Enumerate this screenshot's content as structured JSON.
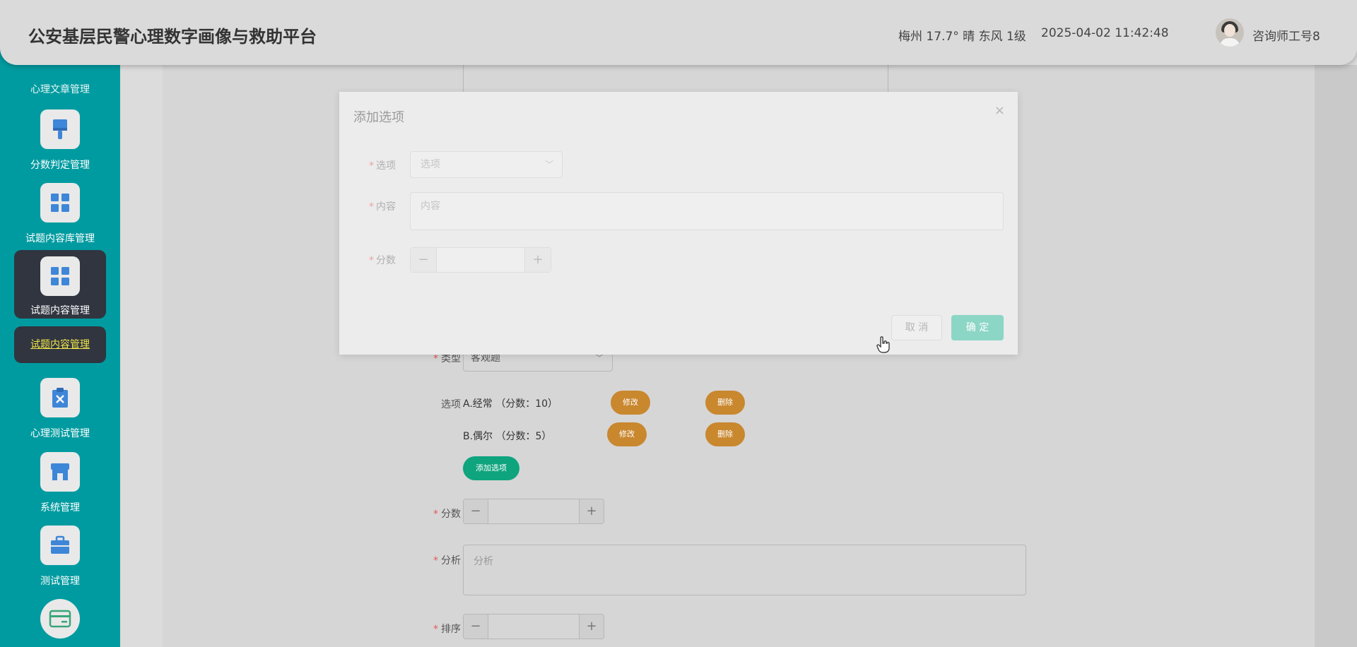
{
  "header": {
    "title": "公安基层民警心理数字画像与救助平台",
    "weather": "梅州 17.7° 晴 东风 1级",
    "datetime": "2025-04-02 11:42:48",
    "username": "咨询师工号8"
  },
  "sidebar": {
    "cut_label": "心理文章管理",
    "items": [
      {
        "label": "分数判定管理",
        "icon": "brush-icon"
      },
      {
        "label": "试题内容库管理",
        "icon": "grid-icon"
      },
      {
        "label": "试题内容管理",
        "icon": "grid-icon"
      },
      {
        "label": "心理测试管理",
        "icon": "clipboard-x-icon"
      },
      {
        "label": "系统管理",
        "icon": "store-icon"
      },
      {
        "label": "测试管理",
        "icon": "briefcase-icon"
      },
      {
        "label": "",
        "icon": "card-icon"
      }
    ],
    "active_sub": "试题内容管理",
    "accent": "#009ba0"
  },
  "form": {
    "type_label": "类型",
    "type_value": "客观题",
    "options_label": "选项",
    "options": [
      {
        "text": "A.经常 （分数：10）",
        "edit": "修改",
        "delete": "删除"
      },
      {
        "text": "B.偶尔 （分数：5）",
        "edit": "修改",
        "delete": "删除"
      }
    ],
    "add_option": "添加选项",
    "score_label": "分数",
    "analysis_label": "分析",
    "analysis_placeholder": "分析",
    "order_label": "排序"
  },
  "modal": {
    "title": "添加选项",
    "close": "×",
    "option_label": "选项",
    "option_placeholder": "选项",
    "content_label": "内容",
    "content_placeholder": "内容",
    "score_label": "分数",
    "cancel": "取 消",
    "confirm": "确 定"
  }
}
